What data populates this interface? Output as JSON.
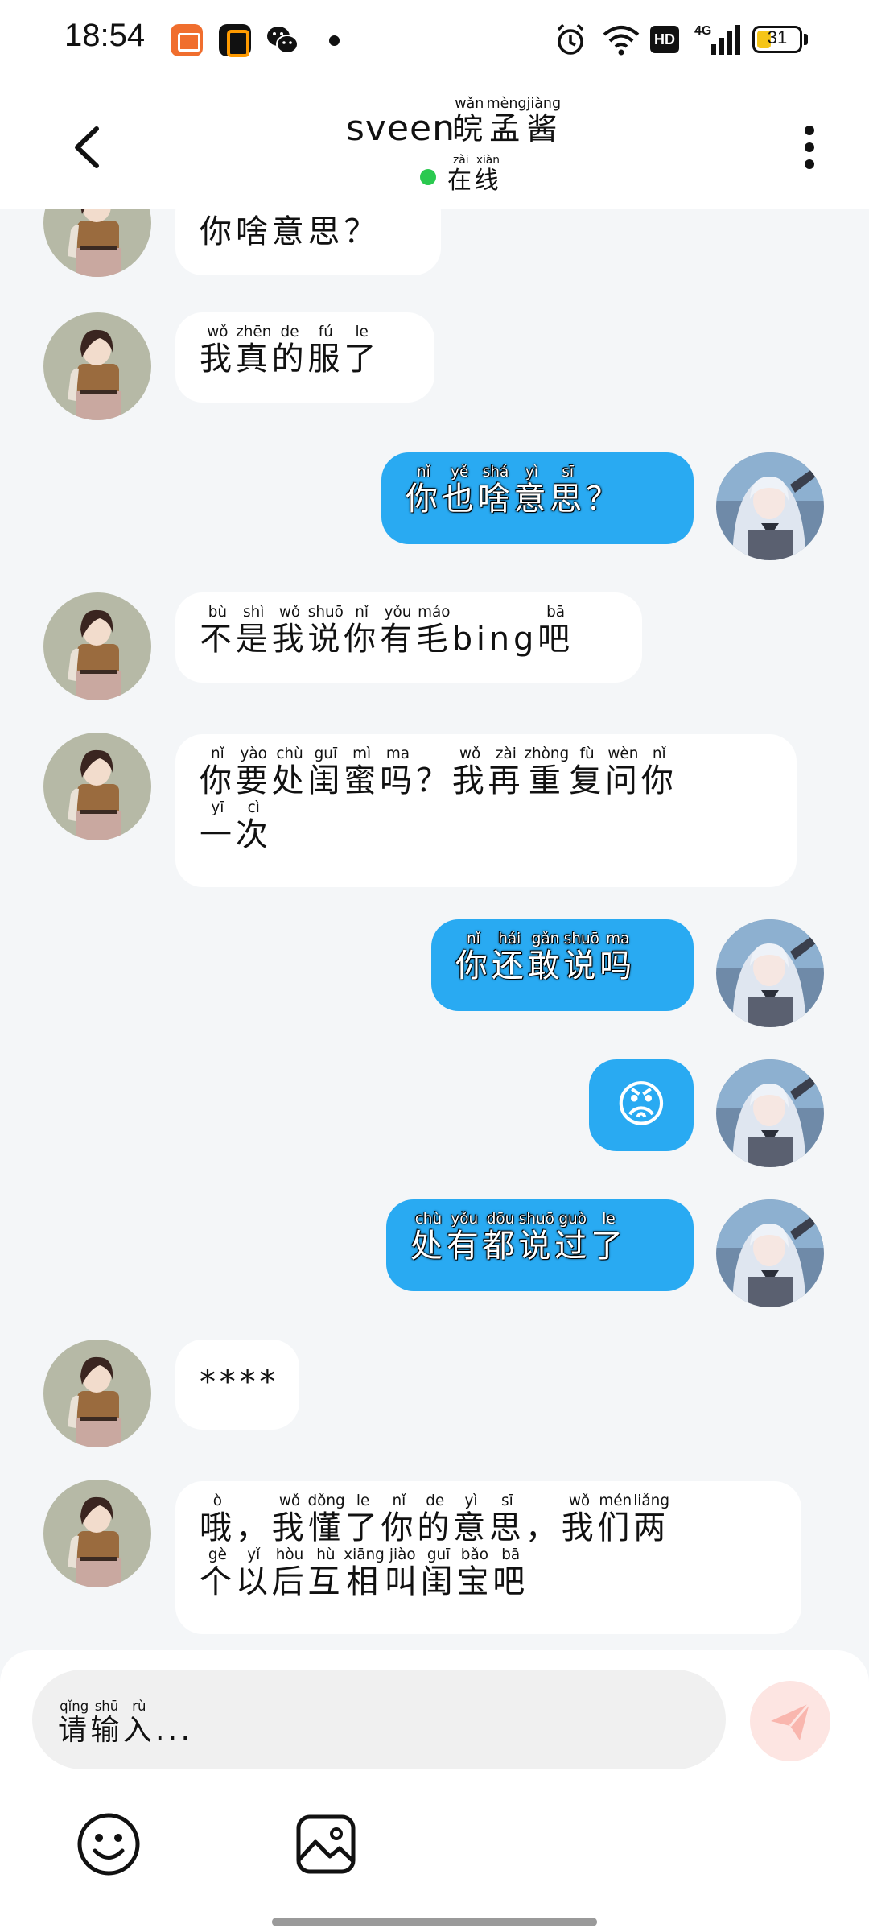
{
  "status_bar": {
    "time": "18:54",
    "hd_label": "HD",
    "network_label": "4G",
    "battery_level": "31",
    "icons": [
      "books-app-icon",
      "zero-app-icon",
      "wechat-icon",
      "notification-dot",
      "alarm-icon",
      "wifi-icon",
      "signal-icon",
      "battery-icon"
    ]
  },
  "header": {
    "contact_name": "sveen",
    "nickname": [
      {
        "hanzi": "皖",
        "pinyin": "wǎn"
      },
      {
        "hanzi": "孟",
        "pinyin": "mèng"
      },
      {
        "hanzi": "酱",
        "pinyin": "jiàng"
      }
    ],
    "status": [
      {
        "hanzi": "在",
        "pinyin": "zài"
      },
      {
        "hanzi": "线",
        "pinyin": "xiàn"
      }
    ],
    "status_color": "#2ac94f"
  },
  "messages": [
    {
      "side": "in",
      "lines": [
        [
          {
            "hanzi": "你",
            "pinyin": ""
          },
          {
            "hanzi": "啥",
            "pinyin": ""
          },
          {
            "hanzi": "意",
            "pinyin": ""
          },
          {
            "hanzi": "思",
            "pinyin": ""
          },
          {
            "hanzi": "？",
            "pinyin": ""
          }
        ]
      ]
    },
    {
      "side": "in",
      "lines": [
        [
          {
            "hanzi": "我",
            "pinyin": "wǒ"
          },
          {
            "hanzi": "真",
            "pinyin": "zhēn"
          },
          {
            "hanzi": "的",
            "pinyin": "de"
          },
          {
            "hanzi": "服",
            "pinyin": "fú"
          },
          {
            "hanzi": "了",
            "pinyin": "le"
          }
        ]
      ]
    },
    {
      "side": "out",
      "lines": [
        [
          {
            "hanzi": "你",
            "pinyin": "nǐ"
          },
          {
            "hanzi": "也",
            "pinyin": "yě"
          },
          {
            "hanzi": "啥",
            "pinyin": "shá"
          },
          {
            "hanzi": "意",
            "pinyin": "yì"
          },
          {
            "hanzi": "思",
            "pinyin": "sī"
          },
          {
            "hanzi": "？",
            "pinyin": ""
          }
        ]
      ]
    },
    {
      "side": "in",
      "lines": [
        [
          {
            "hanzi": "不",
            "pinyin": "bù"
          },
          {
            "hanzi": "是",
            "pinyin": "shì"
          },
          {
            "hanzi": "我",
            "pinyin": "wǒ"
          },
          {
            "hanzi": "说",
            "pinyin": "shuō"
          },
          {
            "hanzi": "你",
            "pinyin": "nǐ"
          },
          {
            "hanzi": "有",
            "pinyin": "yǒu"
          },
          {
            "hanzi": "毛",
            "pinyin": "máo"
          },
          {
            "hanzi": "bing",
            "pinyin": ""
          },
          {
            "hanzi": "吧",
            "pinyin": "bā"
          }
        ]
      ]
    },
    {
      "side": "in",
      "lines": [
        [
          {
            "hanzi": "你",
            "pinyin": "nǐ"
          },
          {
            "hanzi": "要",
            "pinyin": "yào"
          },
          {
            "hanzi": "处",
            "pinyin": "chù"
          },
          {
            "hanzi": "闺",
            "pinyin": "guī"
          },
          {
            "hanzi": "蜜",
            "pinyin": "mì"
          },
          {
            "hanzi": "吗",
            "pinyin": "ma"
          },
          {
            "hanzi": "？",
            "pinyin": ""
          },
          {
            "hanzi": "我",
            "pinyin": "wǒ"
          },
          {
            "hanzi": "再",
            "pinyin": "zài"
          },
          {
            "hanzi": "重",
            "pinyin": "zhòng"
          },
          {
            "hanzi": "复",
            "pinyin": "fù"
          },
          {
            "hanzi": "问",
            "pinyin": "wèn"
          },
          {
            "hanzi": "你",
            "pinyin": "nǐ"
          }
        ],
        [
          {
            "hanzi": "一",
            "pinyin": "yī"
          },
          {
            "hanzi": "次",
            "pinyin": "cì"
          }
        ]
      ]
    },
    {
      "side": "out",
      "lines": [
        [
          {
            "hanzi": "你",
            "pinyin": "nǐ"
          },
          {
            "hanzi": "还",
            "pinyin": "hái"
          },
          {
            "hanzi": "敢",
            "pinyin": "gǎn"
          },
          {
            "hanzi": "说",
            "pinyin": "shuō"
          },
          {
            "hanzi": "吗",
            "pinyin": "ma"
          }
        ]
      ]
    },
    {
      "side": "out",
      "emoji": "😡"
    },
    {
      "side": "out",
      "lines": [
        [
          {
            "hanzi": "处",
            "pinyin": "chù"
          },
          {
            "hanzi": "有",
            "pinyin": "yǒu"
          },
          {
            "hanzi": "都",
            "pinyin": "dōu"
          },
          {
            "hanzi": "说",
            "pinyin": "shuō"
          },
          {
            "hanzi": "过",
            "pinyin": "guò"
          },
          {
            "hanzi": "了",
            "pinyin": "le"
          }
        ]
      ]
    },
    {
      "side": "in",
      "lines": [
        [
          {
            "hanzi": "****",
            "pinyin": ""
          }
        ]
      ]
    },
    {
      "side": "in",
      "lines": [
        [
          {
            "hanzi": "哦",
            "pinyin": "ò"
          },
          {
            "hanzi": "，",
            "pinyin": ""
          },
          {
            "hanzi": "我",
            "pinyin": "wǒ"
          },
          {
            "hanzi": "懂",
            "pinyin": "dǒng"
          },
          {
            "hanzi": "了",
            "pinyin": "le"
          },
          {
            "hanzi": "你",
            "pinyin": "nǐ"
          },
          {
            "hanzi": "的",
            "pinyin": "de"
          },
          {
            "hanzi": "意",
            "pinyin": "yì"
          },
          {
            "hanzi": "思",
            "pinyin": "sī"
          },
          {
            "hanzi": "，",
            "pinyin": ""
          },
          {
            "hanzi": "我",
            "pinyin": "wǒ"
          },
          {
            "hanzi": "们",
            "pinyin": "mén"
          },
          {
            "hanzi": "两",
            "pinyin": "liǎng"
          }
        ],
        [
          {
            "hanzi": "个",
            "pinyin": "gè"
          },
          {
            "hanzi": "以",
            "pinyin": "yǐ"
          },
          {
            "hanzi": "后",
            "pinyin": "hòu"
          },
          {
            "hanzi": "互",
            "pinyin": "hù"
          },
          {
            "hanzi": "相",
            "pinyin": "xiāng"
          },
          {
            "hanzi": "叫",
            "pinyin": "jiào"
          },
          {
            "hanzi": "闺",
            "pinyin": "guī"
          },
          {
            "hanzi": "宝",
            "pinyin": "bǎo"
          },
          {
            "hanzi": "吧",
            "pinyin": "bā"
          }
        ]
      ]
    }
  ],
  "input": {
    "placeholder": [
      {
        "hanzi": "请",
        "pinyin": "qǐng"
      },
      {
        "hanzi": "输",
        "pinyin": "shū"
      },
      {
        "hanzi": "入",
        "pinyin": "rù"
      },
      {
        "hanzi": "...",
        "pinyin": ""
      }
    ],
    "send_color": "#fde5e2"
  },
  "toolbar": {
    "icons": [
      "emoji-icon",
      "image-icon"
    ]
  },
  "colors": {
    "outgoing_bubble": "#29aaf2",
    "incoming_bubble": "#ffffff",
    "background": "#f4f6f8"
  }
}
